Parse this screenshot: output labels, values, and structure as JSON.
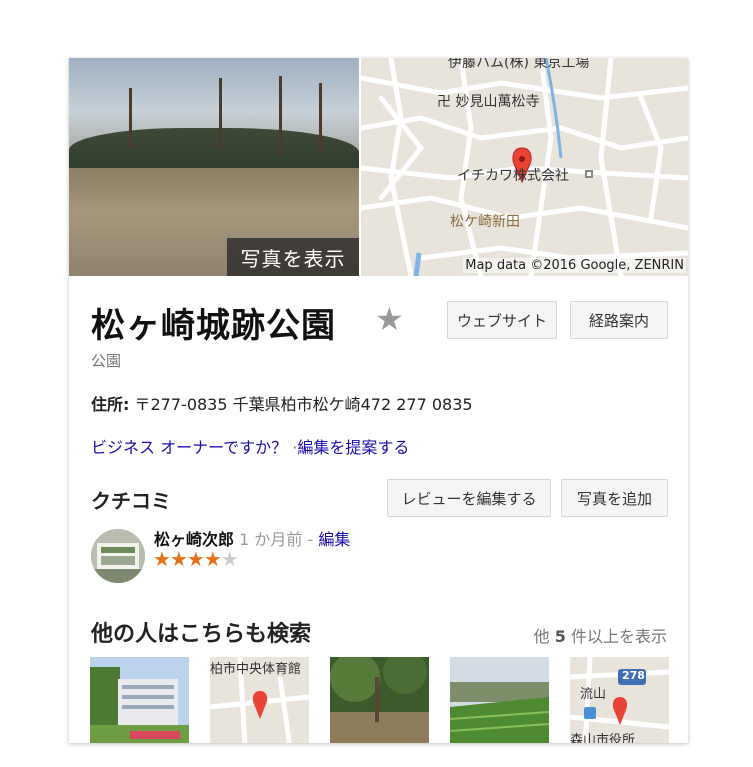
{
  "hero": {
    "photo_button": "写真を表示",
    "map": {
      "labels": [
        "伊藤ハム(株) 東京工場",
        "卍 妙見山萬松寺",
        "イチカワ株式会社",
        "松ケ崎新田"
      ],
      "credit": "Map data ©2016 Google, ZENRIN"
    }
  },
  "place": {
    "title": "松ヶ崎城跡公園",
    "category": "公園",
    "address_label": "住所:",
    "address_value": "〒277-0835 千葉県柏市松ケ崎472 277 0835",
    "owner_link": "ビジネス オーナーですか？",
    "owner_sep": "·",
    "suggest_edit": "編集を提案する"
  },
  "buttons": {
    "website": "ウェブサイト",
    "directions": "経路案内",
    "edit_review": "レビューを編集する",
    "add_photo": "写真を追加"
  },
  "reviews": {
    "heading": "クチコミ",
    "reviewer_name": "松ヶ崎次郎",
    "time": "1 か月前",
    "dash": "-",
    "edit": "編集",
    "rating": 4,
    "rating_max": 5
  },
  "others": {
    "heading": "他の人はこちらも検索",
    "more_prefix": "他",
    "more_count": "5",
    "more_suffix": "件以上を表示",
    "thumb1_label": "柏市中央体育館",
    "thumb4_label": "流山",
    "thumb4_badge": "278",
    "thumb4_bottom": "森山市役所"
  },
  "colors": {
    "accent_star": "#e7711b",
    "link": "#1a0dab",
    "map_pin": "#ea4335"
  }
}
